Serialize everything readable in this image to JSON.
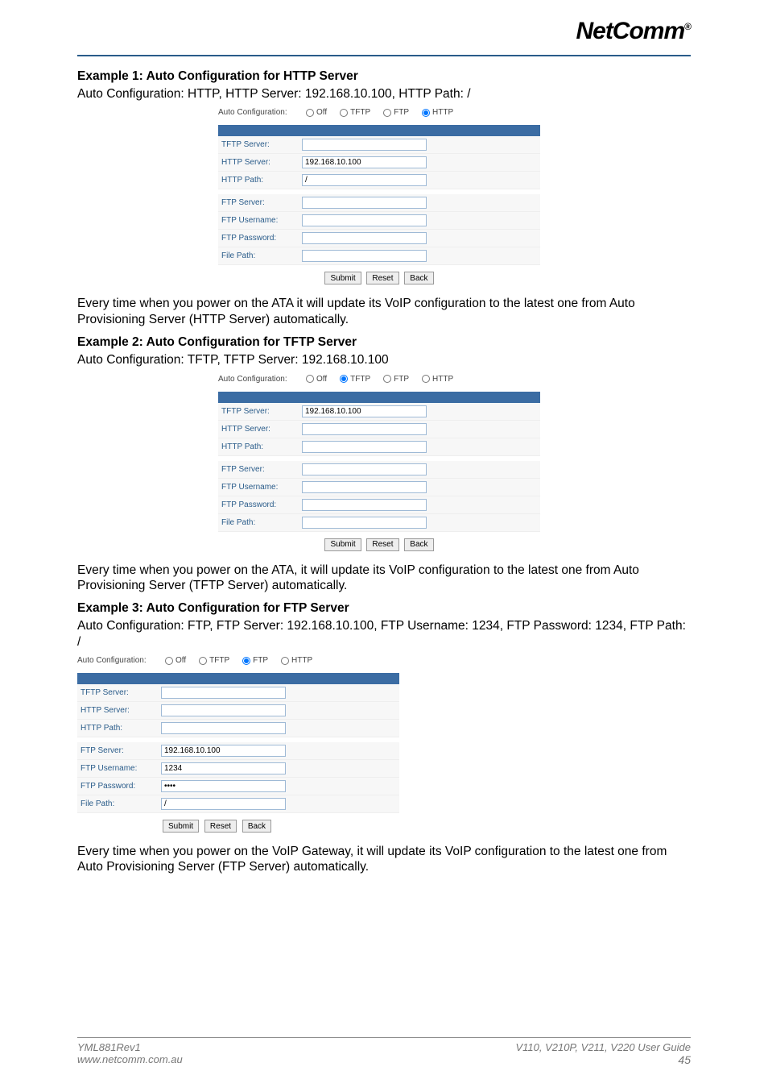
{
  "logo": {
    "text": "NetComm",
    "mark": "®"
  },
  "example1": {
    "heading": "Example 1: Auto Configuration for HTTP Server",
    "subtitle": "Auto Configuration: HTTP, HTTP Server: 192.168.10.100, HTTP Path: /",
    "radios": {
      "label": "Auto Configuration:",
      "off": "Off",
      "tftp": "TFTP",
      "ftp": "FTP",
      "http": "HTTP"
    },
    "fields": {
      "tftp_server_k": "TFTP Server:",
      "tftp_server_v": "",
      "http_server_k": "HTTP Server:",
      "http_server_v": "192.168.10.100",
      "http_path_k": "HTTP Path:",
      "http_path_v": "/",
      "ftp_server_k": "FTP Server:",
      "ftp_server_v": "",
      "ftp_user_k": "FTP Username:",
      "ftp_user_v": "",
      "ftp_pass_k": "FTP Password:",
      "ftp_pass_v": "",
      "file_path_k": "File Path:",
      "file_path_v": ""
    },
    "buttons": {
      "submit": "Submit",
      "reset": "Reset",
      "back": "Back"
    },
    "body": "Every time when you power on the ATA it will update its VoIP configuration to the latest one from Auto Provisioning Server (HTTP Server) automatically."
  },
  "example2": {
    "heading": "Example 2: Auto Configuration for TFTP Server",
    "subtitle": "Auto Configuration: TFTP, TFTP Server: 192.168.10.100",
    "radios": {
      "label": "Auto Configuration:",
      "off": "Off",
      "tftp": "TFTP",
      "ftp": "FTP",
      "http": "HTTP"
    },
    "fields": {
      "tftp_server_k": "TFTP Server:",
      "tftp_server_v": "192.168.10.100",
      "http_server_k": "HTTP Server:",
      "http_server_v": "",
      "http_path_k": "HTTP Path:",
      "http_path_v": "",
      "ftp_server_k": "FTP Server:",
      "ftp_server_v": "",
      "ftp_user_k": "FTP Username:",
      "ftp_user_v": "",
      "ftp_pass_k": "FTP Password:",
      "ftp_pass_v": "",
      "file_path_k": "File Path:",
      "file_path_v": ""
    },
    "buttons": {
      "submit": "Submit",
      "reset": "Reset",
      "back": "Back"
    },
    "body": "Every time when you power on the ATA, it will update its VoIP configuration to the latest one from Auto Provisioning Server (TFTP Server) automatically."
  },
  "example3": {
    "heading": "Example 3: Auto Configuration for FTP Server",
    "subtitle": "Auto Configuration: FTP, FTP Server: 192.168.10.100, FTP Username: 1234, FTP Password: 1234, FTP Path: /",
    "radios": {
      "label": "Auto Configuration:",
      "off": "Off",
      "tftp": "TFTP",
      "ftp": "FTP",
      "http": "HTTP"
    },
    "fields": {
      "tftp_server_k": "TFTP Server:",
      "tftp_server_v": "",
      "http_server_k": "HTTP Server:",
      "http_server_v": "",
      "http_path_k": "HTTP Path:",
      "http_path_v": "",
      "ftp_server_k": "FTP Server:",
      "ftp_server_v": "192.168.10.100",
      "ftp_user_k": "FTP Username:",
      "ftp_user_v": "1234",
      "ftp_pass_k": "FTP Password:",
      "ftp_pass_v": "••••",
      "file_path_k": "File Path:",
      "file_path_v": "/"
    },
    "buttons": {
      "submit": "Submit",
      "reset": "Reset",
      "back": "Back"
    },
    "body": "Every time when you power on the VoIP Gateway, it will update its VoIP configuration to the latest one from Auto Provisioning Server (FTP Server) automatically."
  },
  "footer": {
    "rev": "YML881Rev1",
    "url": "www.netcomm.com.au",
    "guide1": "V110, V210P, V211, V220 ",
    "guide2": "User Guide",
    "page": "45"
  }
}
